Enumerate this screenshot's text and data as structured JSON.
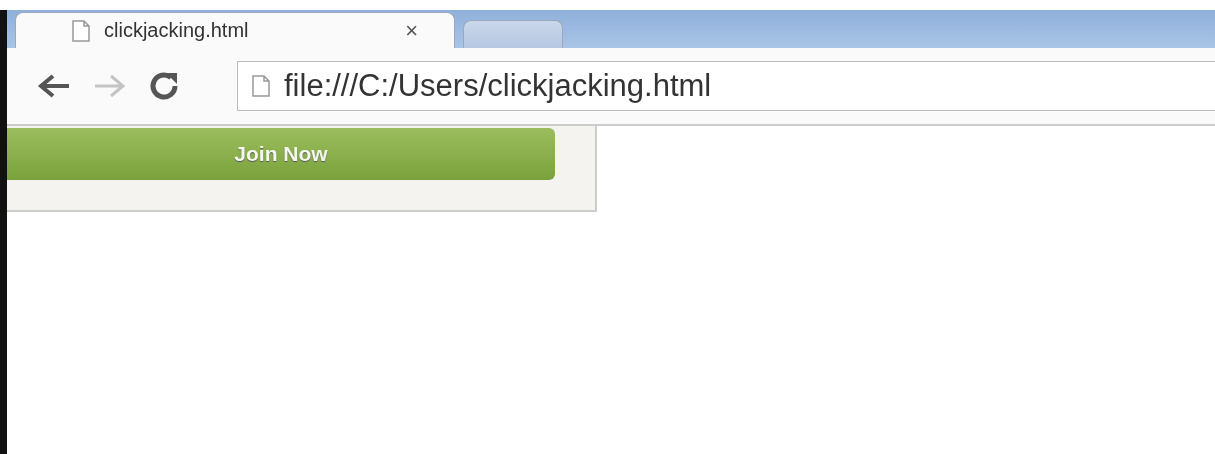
{
  "tabs": [
    {
      "title": "clickjacking.html",
      "close": "×",
      "selected": true
    },
    {
      "selected": false
    }
  ],
  "nav": [
    {
      "kind": "back",
      "disabled": false
    },
    {
      "kind": "forward",
      "disabled": true
    },
    {
      "kind": "reload",
      "disabled": false
    }
  ],
  "address": {
    "value": "file:///C:/Users/clickjacking.html"
  },
  "page": {
    "button": "Join Now"
  }
}
